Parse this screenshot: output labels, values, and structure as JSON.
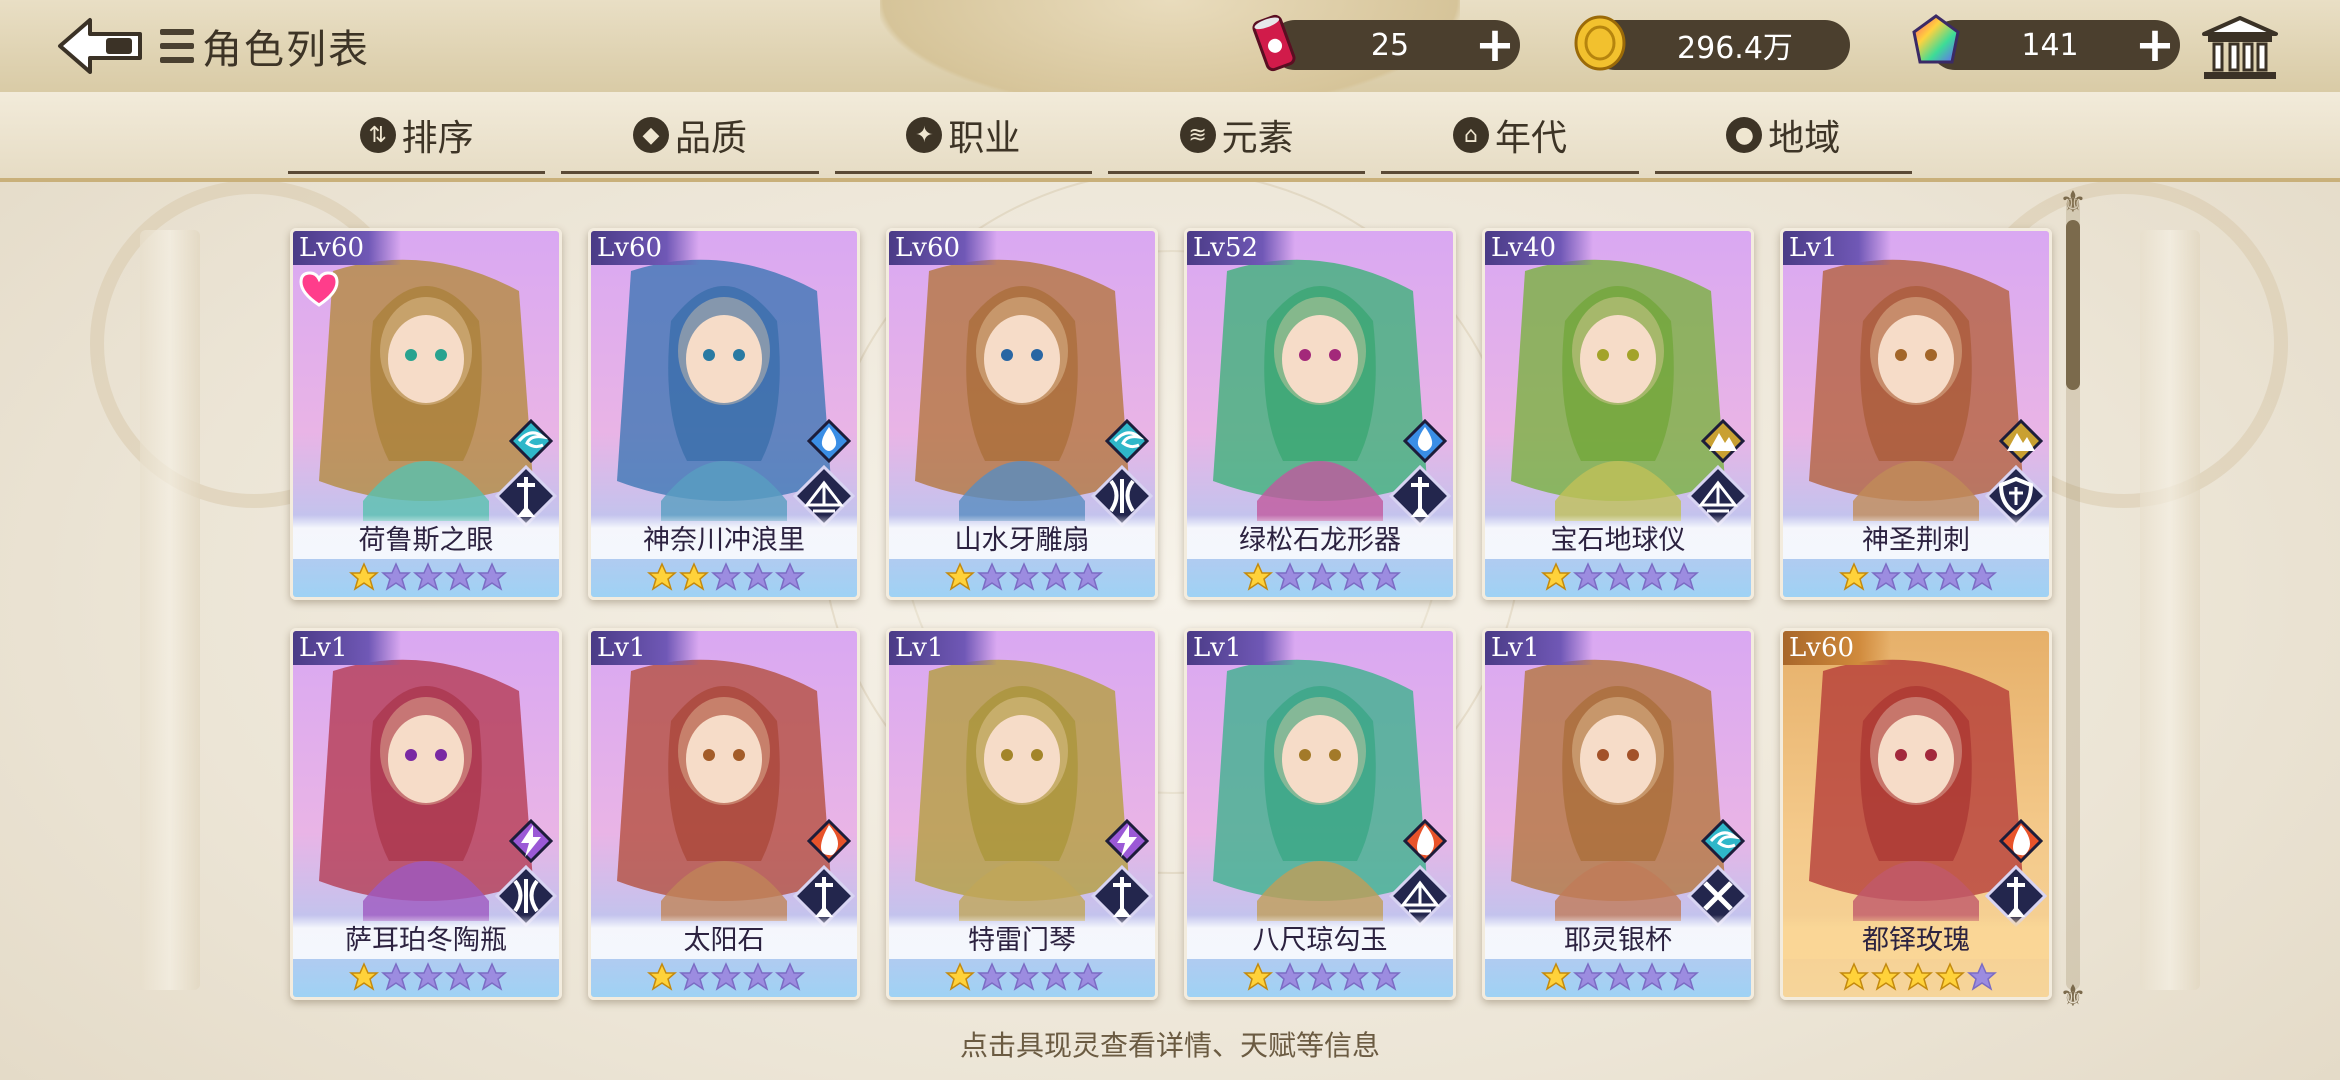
{
  "header": {
    "title": "角色列表",
    "resources": [
      {
        "icon": "soda-can-icon",
        "value": "25"
      },
      {
        "icon": "gold-coin-icon",
        "value": "296.4万"
      },
      {
        "icon": "rainbow-gem-icon",
        "value": "141"
      }
    ],
    "plus_label": "+"
  },
  "filters": [
    {
      "icon": "sort-icon",
      "glyph": "⇅",
      "label": "排序"
    },
    {
      "icon": "quality-gem-icon",
      "glyph": "◆",
      "label": "品质"
    },
    {
      "icon": "profession-icon",
      "glyph": "✦",
      "label": "职业"
    },
    {
      "icon": "element-swirl-icon",
      "glyph": "≋",
      "label": "元素"
    },
    {
      "icon": "era-icon",
      "glyph": "⌂",
      "label": "年代"
    },
    {
      "icon": "location-pin-icon",
      "glyph": "●",
      "label": "地域"
    }
  ],
  "cards": [
    {
      "level": "Lv60",
      "name": "荷鲁斯之眼",
      "stars": 1,
      "max_stars": 5,
      "element": "wind",
      "role": "sword",
      "favorite": true,
      "rarity": "purple"
    },
    {
      "level": "Lv60",
      "name": "神奈川冲浪里",
      "stars": 2,
      "max_stars": 5,
      "element": "water",
      "role": "book",
      "favorite": false,
      "rarity": "purple"
    },
    {
      "level": "Lv60",
      "name": "山水牙雕扇",
      "stars": 1,
      "max_stars": 5,
      "element": "wind",
      "role": "bow",
      "favorite": false,
      "rarity": "purple"
    },
    {
      "level": "Lv52",
      "name": "绿松石龙形器",
      "stars": 1,
      "max_stars": 5,
      "element": "water",
      "role": "sword",
      "favorite": false,
      "rarity": "purple"
    },
    {
      "level": "Lv40",
      "name": "宝石地球仪",
      "stars": 1,
      "max_stars": 5,
      "element": "earth",
      "role": "book",
      "favorite": false,
      "rarity": "purple"
    },
    {
      "level": "Lv1",
      "name": "神圣荆刺",
      "stars": 1,
      "max_stars": 5,
      "element": "earth",
      "role": "shield",
      "favorite": false,
      "rarity": "purple"
    },
    {
      "level": "Lv1",
      "name": "萨耳珀冬陶瓶",
      "stars": 1,
      "max_stars": 5,
      "element": "thunder",
      "role": "bow",
      "favorite": false,
      "rarity": "purple"
    },
    {
      "level": "Lv1",
      "name": "太阳石",
      "stars": 1,
      "max_stars": 5,
      "element": "fire",
      "role": "sword",
      "favorite": false,
      "rarity": "purple"
    },
    {
      "level": "Lv1",
      "name": "特雷门琴",
      "stars": 1,
      "max_stars": 5,
      "element": "thunder",
      "role": "sword",
      "favorite": false,
      "rarity": "purple"
    },
    {
      "level": "Lv1",
      "name": "八尺琼勾玉",
      "stars": 1,
      "max_stars": 5,
      "element": "fire",
      "role": "book",
      "favorite": false,
      "rarity": "purple"
    },
    {
      "level": "Lv1",
      "name": "耶灵银杯",
      "stars": 1,
      "max_stars": 5,
      "element": "wind",
      "role": "cross",
      "favorite": false,
      "rarity": "purple"
    },
    {
      "level": "Lv60",
      "name": "都铎玫瑰",
      "stars": 4,
      "max_stars": 5,
      "element": "fire",
      "role": "sword",
      "favorite": false,
      "rarity": "gold"
    }
  ],
  "hint": "点击具现灵查看详情、天赋等信息",
  "colors": {
    "header_bg": "#d9cba6",
    "resource_pill": "#4b3f2e",
    "card_purple_top": "#c8a6ef",
    "card_purple_bottom": "#8fc7ef",
    "card_gold": "#e0a560",
    "text_dark": "#3d3426"
  }
}
